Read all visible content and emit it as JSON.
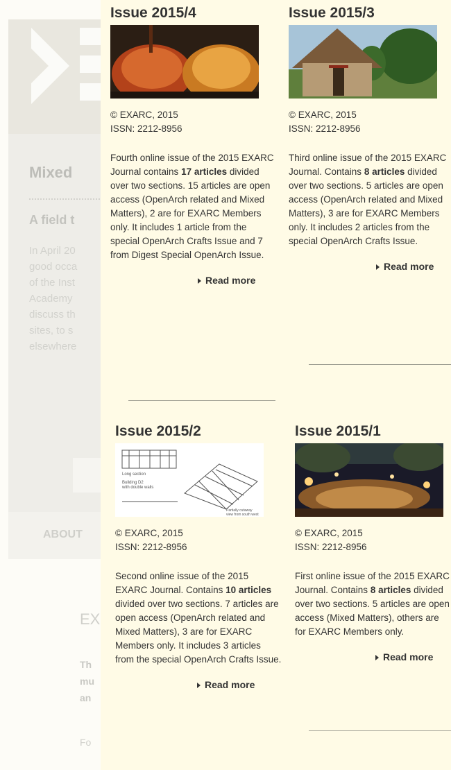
{
  "background": {
    "mixed_heading": "Mixed",
    "field_heading": "A field t",
    "lines": [
      "In April 20",
      "good occa",
      "of the Inst",
      "Academy",
      "discuss th",
      "sites, to s",
      "elsewhere"
    ],
    "about_label": "ABOUT",
    "ex_heading": "EX",
    "snippet_lines": [
      "Th",
      "mu",
      "an"
    ],
    "fo_text": "Fo"
  },
  "issues": [
    {
      "title": "Issue 2015/4",
      "copyright": "© EXARC, 2015",
      "issn": "ISSN: 2212-8956",
      "desc_before": "Fourth online issue of the 2015 EXARC Journal contains ",
      "desc_bold": "17 articles",
      "desc_after": " divided over two sections. 15 articles are open access (OpenArch related and Mixed Matters), 2 are for EXARC Members only. It includes 1 article from the special OpenArch Crafts Issue and 7 from Digest Special OpenArch Issue.",
      "read_more": "Read more",
      "image_icon": "bowls-photo-icon"
    },
    {
      "title": "Issue 2015/3",
      "copyright": "© EXARC, 2015",
      "issn": "ISSN: 2212-8956",
      "desc_before": "Third online issue of the 2015 EXARC Journal. Contains ",
      "desc_bold": "8 articles",
      "desc_after": " divided over two sections. 5 articles are open access (OpenArch related and Mixed Matters), 3 are for EXARC Members only. It includes 2 articles from the special OpenArch Crafts Issue.",
      "read_more": "Read more",
      "image_icon": "longhouse-photo-icon"
    },
    {
      "title": "Issue 2015/2",
      "copyright": "© EXARC, 2015",
      "issn": "ISSN: 2212-8956",
      "desc_before": "Second online issue of the 2015 EXARC Journal. Contains ",
      "desc_bold": "10 articles",
      "desc_after": " divided over two sections. 7 articles are open access (OpenArch related and Mixed Matters), 3 are for EXARC Members only. It includes 3 articles from the special OpenArch Crafts Issue.",
      "read_more": "Read more",
      "image_icon": "building-drawing-icon",
      "drawing_labels": {
        "long_section": "Long section",
        "building": "Building D2",
        "walls": "with double walls",
        "cutaway": "Partially cutaway",
        "view": "view from south west"
      }
    },
    {
      "title": "Issue 2015/1",
      "copyright": "© EXARC, 2015",
      "issn": "ISSN: 2212-8956",
      "desc_before": "First online issue of the 2015 EXARC Journal. Contains ",
      "desc_bold": "8 articles",
      "desc_after": " divided over two sections. 5 articles are open access (Mixed Matters), others are for EXARC Members only.",
      "read_more": "Read more",
      "image_icon": "night-gathering-photo-icon"
    }
  ]
}
